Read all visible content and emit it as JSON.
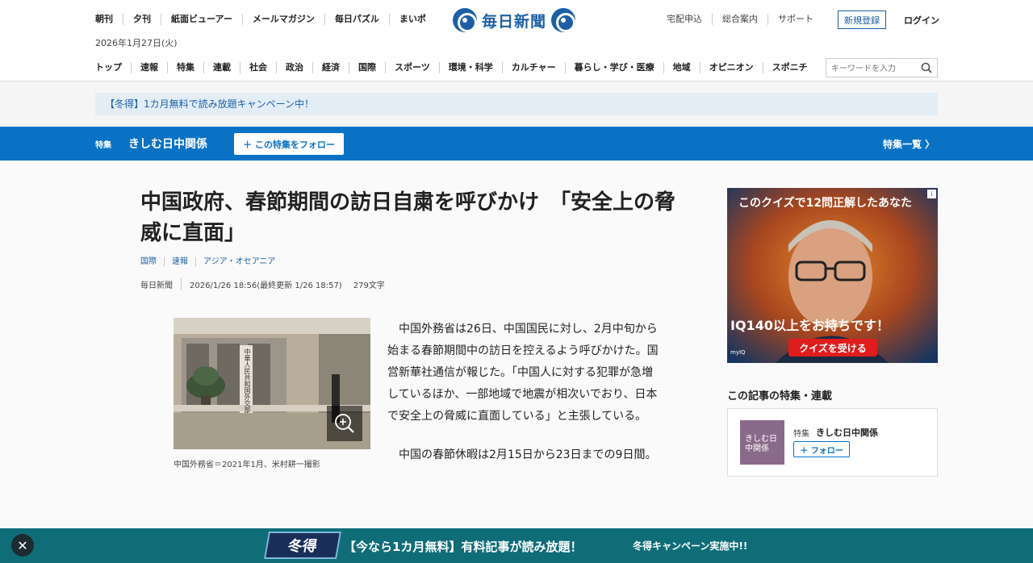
{
  "header": {
    "top_links": [
      "朝刊",
      "夕刊",
      "紙面ビューアー",
      "メールマガジン",
      "毎日パズル",
      "まいポ"
    ],
    "date": "2026年1月27日(火)",
    "logo_text": "毎日新聞",
    "right_links": [
      "宅配申込",
      "総合案内",
      "サポート"
    ],
    "signup_label": "新規登録",
    "login_label": "ログイン",
    "nav": [
      "トップ",
      "速報",
      "特集",
      "連載",
      "社会",
      "政治",
      "経済",
      "国際",
      "スポーツ",
      "環境・科学",
      "カルチャー",
      "暮らし・学び・医療",
      "地域",
      "オピニオン",
      "スポニチ"
    ],
    "search_placeholder": "キーワードを入力"
  },
  "campaign_banner": "【冬得】1カ月無料で読み放題キャンペーン中！",
  "feature_bar": {
    "label": "特集",
    "title": "きしむ日中関係",
    "follow_label": "＋ この特集をフォロー",
    "list_label": "特集一覧 〉"
  },
  "article": {
    "headline": "中国政府、春節期間の訪日自粛を呼びかけ　「安全上の脅威に直面」",
    "categories": [
      "国際",
      "速報",
      "アジア・オセアニア"
    ],
    "source": "毎日新聞",
    "datetime": "2026/1/26 18:56(最終更新 1/26 18:57)",
    "char_count": "279文字",
    "photo_caption": "中国外務省＝2021年1月、米村耕一撮影",
    "photo_sign": "中華人民共和国外交部",
    "paragraphs": [
      "中国外務省は26日、中国国民に対し、2月中旬から始まる春節期間中の訪日を控えるよう呼びかけた。国営新華社通信が報じた。「中国人に対する犯罪が急増しているほか、一部地域で地震が相次いでおり、日本で安全上の脅威に直面している」と主張している。",
      "中国の春節休暇は2月15日から23日までの9日間。"
    ]
  },
  "ad": {
    "headline": "このクイズで12問正解したあなた",
    "body": "IQ140以上をお持ちです！",
    "button": "クイズを受ける",
    "badge": "myIQ"
  },
  "sidebar": {
    "heading": "この記事の特集・連載",
    "card_label": "特集",
    "card_title": "きしむ日中関係",
    "card_follow": "＋ フォロー",
    "thumb_text": "きしむ日中関係"
  },
  "bottom_banner": {
    "badge": "冬得",
    "main_text": "【今なら1カ月無料】有料記事が読み放題！",
    "sub_text": "冬得キャンペーン実施中!!"
  }
}
